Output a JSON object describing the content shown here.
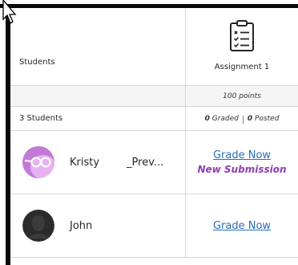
{
  "grid": {
    "students_header": "Students",
    "assignment": {
      "name": "Assignment 1",
      "icon": "checklist-icon",
      "points": "100 points",
      "graded_count": "0",
      "graded_label": "Graded",
      "posted_count": "0",
      "posted_label": "Posted"
    },
    "student_count": "3 Students",
    "students": [
      {
        "name": "Kristy",
        "extra": "_Prev...",
        "avatar": "avatar-purple-glasses",
        "grade_label": "Grade Now",
        "status": "New Submission"
      },
      {
        "name": "John",
        "extra": "",
        "avatar": "avatar-silhouette",
        "grade_label": "Grade Now",
        "status": ""
      }
    ]
  },
  "colors": {
    "link": "#2a6ebb",
    "new_submission": "#8e3db3",
    "avatar_purple": "#c27ad6",
    "border": "#d6d6d6"
  }
}
